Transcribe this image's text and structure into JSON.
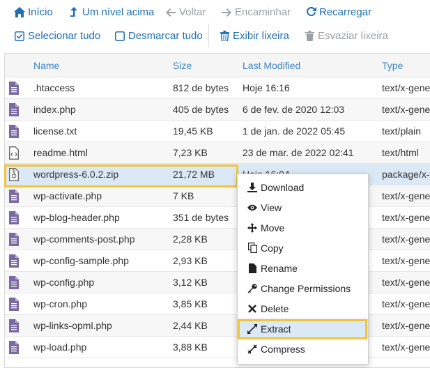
{
  "toolbar": {
    "home": "Início",
    "up": "Um nível acima",
    "back": "Voltar",
    "forward": "Encaminhar",
    "reload": "Recarregar",
    "select_all": "Selecionar tudo",
    "unselect_all": "Desmarcar tudo",
    "view_trash": "Exibir lixeira",
    "empty_trash": "Esvaziar lixeira"
  },
  "columns": {
    "name": "Name",
    "size": "Size",
    "modified": "Last Modified",
    "type": "Type"
  },
  "files": [
    {
      "name": ".htaccess",
      "size": "812 de bytes",
      "modified": "Hoje 16:16",
      "type": "text/x-generic",
      "icon": "file-text-icon"
    },
    {
      "name": "index.php",
      "size": "405 de bytes",
      "modified": "6 de fev. de 2020 12:03",
      "type": "text/x-generic",
      "icon": "file-text-icon"
    },
    {
      "name": "license.txt",
      "size": "19,45 KB",
      "modified": "1 de jan. de 2022 05:45",
      "type": "text/plain",
      "icon": "file-text-icon"
    },
    {
      "name": "readme.html",
      "size": "7,23 KB",
      "modified": "23 de mar. de 2022 02:41",
      "type": "text/html",
      "icon": "file-code-icon"
    },
    {
      "name": "wordpress-6.0.2.zip",
      "size": "21,72 MB",
      "modified": "Hoje 16:04",
      "type": "package/x-generic",
      "icon": "file-zip-icon",
      "selected": true
    },
    {
      "name": "wp-activate.php",
      "size": "7 KB",
      "modified": "",
      "type": "text/x-generic",
      "icon": "file-text-icon"
    },
    {
      "name": "wp-blog-header.php",
      "size": "351 de bytes",
      "modified": "",
      "type": "text/x-generic",
      "icon": "file-text-icon"
    },
    {
      "name": "wp-comments-post.php",
      "size": "2,28 KB",
      "modified": "",
      "type": "text/x-generic",
      "icon": "file-text-icon"
    },
    {
      "name": "wp-config-sample.php",
      "size": "2,93 KB",
      "modified": "",
      "type": "text/x-generic",
      "icon": "file-text-icon"
    },
    {
      "name": "wp-config.php",
      "size": "3,12 KB",
      "modified": "",
      "type": "text/x-generic",
      "icon": "file-text-icon"
    },
    {
      "name": "wp-cron.php",
      "size": "3,85 KB",
      "modified": "",
      "type": "text/x-generic",
      "icon": "file-text-icon"
    },
    {
      "name": "wp-links-opml.php",
      "size": "2,44 KB",
      "modified": "",
      "type": "text/x-generic",
      "icon": "file-text-icon"
    },
    {
      "name": "wp-load.php",
      "size": "3,88 KB",
      "modified": "",
      "type": "text/x-generic",
      "icon": "file-text-icon"
    }
  ],
  "context_menu": [
    {
      "label": "Download",
      "icon": "download-icon"
    },
    {
      "label": "View",
      "icon": "eye-icon"
    },
    {
      "label": "Move",
      "icon": "move-icon"
    },
    {
      "label": "Copy",
      "icon": "copy-icon"
    },
    {
      "label": "Rename",
      "icon": "file-icon"
    },
    {
      "label": "Change Permissions",
      "icon": "key-icon"
    },
    {
      "label": "Delete",
      "icon": "x-icon"
    },
    {
      "label": "Extract",
      "icon": "expand-icon",
      "highlighted": true
    },
    {
      "label": "Compress",
      "icon": "compress-icon"
    }
  ],
  "colors": {
    "accent": "#1f6fb5",
    "header_text": "#3b86c6",
    "highlight": "#f2c43a",
    "file_icon": "#7a6aa3",
    "selected_row": "#dbe9f6"
  }
}
